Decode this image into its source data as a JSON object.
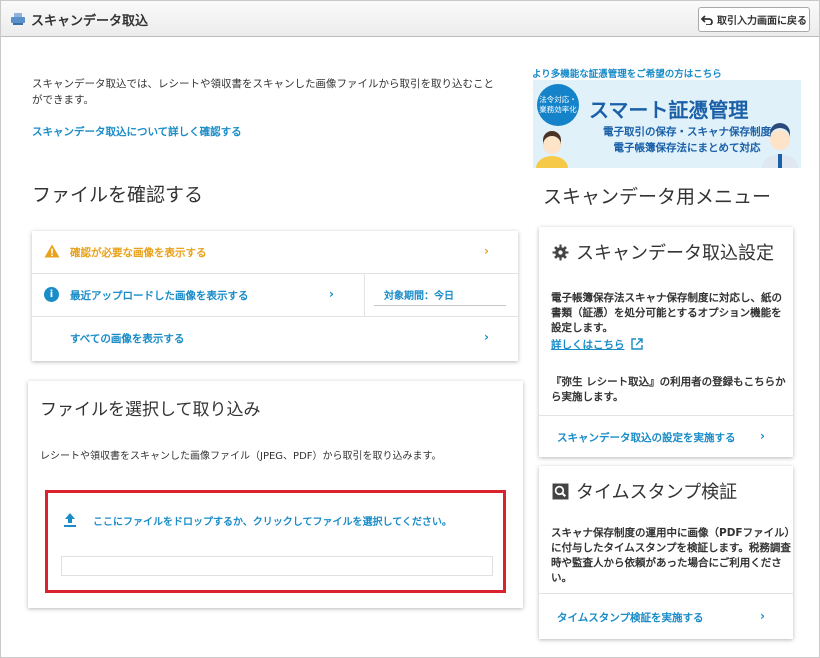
{
  "header": {
    "title": "スキャンデータ取込",
    "back_label": "取引入力画面に戻る"
  },
  "intro": {
    "text": "スキャンデータ取込では、レシートや領収書をスキャンした画像ファイルから取引を取り込むことができます。",
    "link": "スキャンデータ取込について詳しく確認する"
  },
  "promo": {
    "link": "より多機能な証憑管理をご希望の方はこちら",
    "badge": "法令対応・業務効率化",
    "title": "スマート証憑管理",
    "line1": "電子取引の保存・スキャナ保存制度",
    "line2": "電子帳簿保存法にまとめて対応"
  },
  "check": {
    "heading": "ファイルを確認する",
    "rows": [
      {
        "label": "確認が必要な画像を表示する"
      },
      {
        "label": "最近アップロードした画像を表示する",
        "period": "対象期間：今日"
      },
      {
        "label": "すべての画像を表示する"
      }
    ]
  },
  "upload": {
    "title": "ファイルを選択して取り込み",
    "desc": "レシートや領収書をスキャンした画像ファイル（JPEG、PDF）から取引を取り込みます。",
    "drop": "ここにファイルをドロップするか、クリックしてファイルを選択してください。"
  },
  "menu": {
    "heading": "スキャンデータ用メニュー",
    "settings": {
      "title": "スキャンデータ取込設定",
      "desc": "電子帳簿保存法スキャナ保存制度に対応し、紙の書類（証憑）を処分可能とするオプション機能を設定します。",
      "link": "詳しくはこちら",
      "desc2": "『弥生 レシート取込』の利用者の登録もこちらから実施します。",
      "action": "スキャンデータ取込の設定を実施する"
    },
    "timestamp": {
      "title": "タイムスタンプ検証",
      "desc": "スキャナ保存制度の運用中に画像（PDFファイル）に付与したタイムスタンプを検証します。税務調査時や監査人から依頼があった場合にご利用ください。",
      "action": "タイムスタンプ検証を実施する"
    }
  },
  "colors": {
    "accent": "#1a8cc8",
    "warning": "#e8a21b",
    "highlight": "#d9232e"
  }
}
